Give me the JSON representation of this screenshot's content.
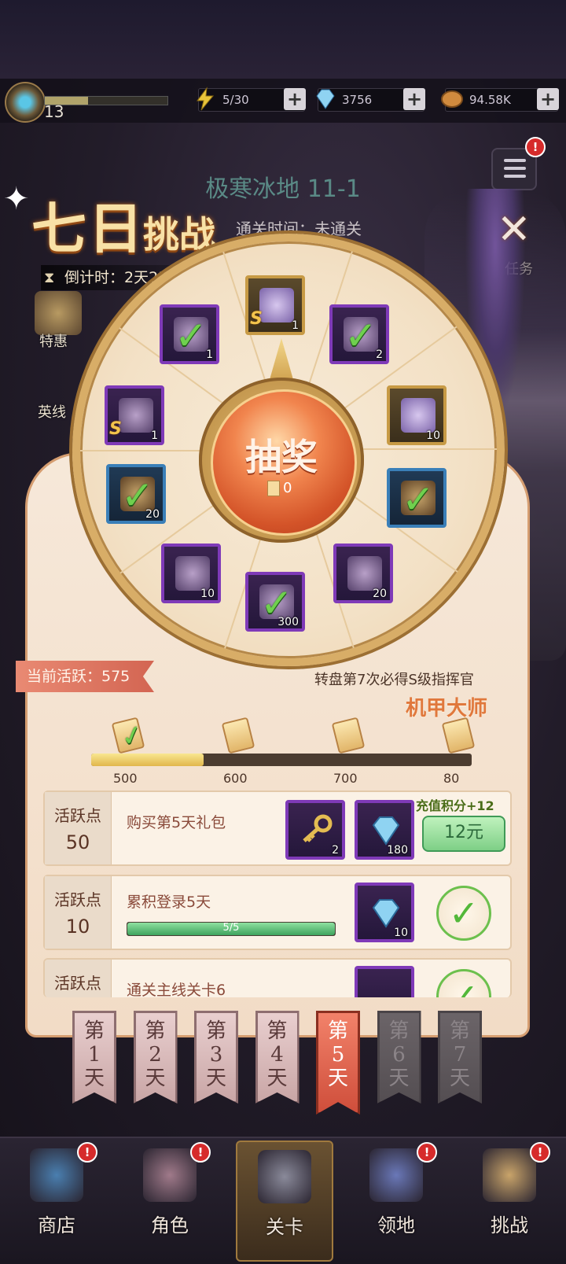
{
  "topbar": {
    "level": "13",
    "xp_fraction": 0.35,
    "energy": "5/30",
    "diamonds": "3756",
    "gold": "94.58K",
    "plus_symbol": "+"
  },
  "stage": {
    "title": "极寒冰地 11-1",
    "subtitle": "通关时间：未通关"
  },
  "side_menu": {
    "badge": "!",
    "left_items": [
      "特惠",
      "英线"
    ],
    "right_label": "任务"
  },
  "event": {
    "title_big": "七日",
    "title_small": "挑战",
    "countdown": "倒计时：2天23时59分",
    "close_symbol": "✕"
  },
  "wheel": {
    "spin_label": "抽奖",
    "tickets": "0",
    "items": [
      {
        "name": "commander-s-portrait",
        "qty": "1",
        "frame": "gold",
        "checked": false,
        "rank": "S"
      },
      {
        "name": "medal",
        "qty": "2",
        "frame": "purple",
        "checked": true
      },
      {
        "name": "crystal-shard",
        "qty": "10",
        "frame": "gold",
        "checked": false
      },
      {
        "name": "book",
        "qty": "",
        "frame": "blue",
        "checked": true
      },
      {
        "name": "cake",
        "qty": "20",
        "frame": "purple",
        "checked": false
      },
      {
        "name": "blue-chest",
        "qty": "300",
        "frame": "purple",
        "checked": true
      },
      {
        "name": "key",
        "qty": "10",
        "frame": "purple",
        "checked": false
      },
      {
        "name": "green-book",
        "qty": "20",
        "frame": "blue",
        "checked": true
      },
      {
        "name": "commander-s-portrait-2",
        "qty": "1",
        "frame": "purple",
        "checked": false,
        "rank": "S"
      },
      {
        "name": "ticket",
        "qty": "1",
        "frame": "purple",
        "checked": true
      }
    ],
    "guarantee": "转盘第7次必得S级指挥官",
    "commander_name": "机甲大师"
  },
  "activity": {
    "current_label": "当前活跃：575",
    "progress_fraction": 0.295,
    "milestones": [
      "500",
      "600",
      "700",
      "80"
    ]
  },
  "tasks": [
    {
      "pts_label": "活跃点",
      "pts": "50",
      "desc": "购买第5天礼包",
      "reward1_qty": "2",
      "reward2_qty": "180",
      "recharge": "充值积分+12",
      "price": "12元"
    },
    {
      "pts_label": "活跃点",
      "pts": "10",
      "desc": "累积登录5天",
      "progress": "5/5",
      "progress_fraction": 1.0,
      "reward_qty": "10"
    },
    {
      "pts_label": "活跃点",
      "pts": "",
      "desc": "通关主线关卡6"
    }
  ],
  "days": [
    {
      "prefix": "第",
      "num": "1",
      "suffix": "天",
      "state": "normal"
    },
    {
      "prefix": "第",
      "num": "2",
      "suffix": "天",
      "state": "normal"
    },
    {
      "prefix": "第",
      "num": "3",
      "suffix": "天",
      "state": "normal"
    },
    {
      "prefix": "第",
      "num": "4",
      "suffix": "天",
      "state": "normal"
    },
    {
      "prefix": "第",
      "num": "5",
      "suffix": "天",
      "state": "active"
    },
    {
      "prefix": "第",
      "num": "6",
      "suffix": "天",
      "state": "locked"
    },
    {
      "prefix": "第",
      "num": "7",
      "suffix": "天",
      "state": "locked"
    }
  ],
  "nav": [
    {
      "label": "商店",
      "icon": "shop-icon"
    },
    {
      "label": "角色",
      "icon": "character-icon"
    },
    {
      "label": "关卡",
      "icon": "crossed-swords-icon"
    },
    {
      "label": "领地",
      "icon": "castle-icon"
    },
    {
      "label": "挑战",
      "icon": "challenge-scroll-icon"
    }
  ],
  "colors": {
    "accent": "#e0783c",
    "panel": "#f6e8d9",
    "check_green": "#6fd04e"
  }
}
